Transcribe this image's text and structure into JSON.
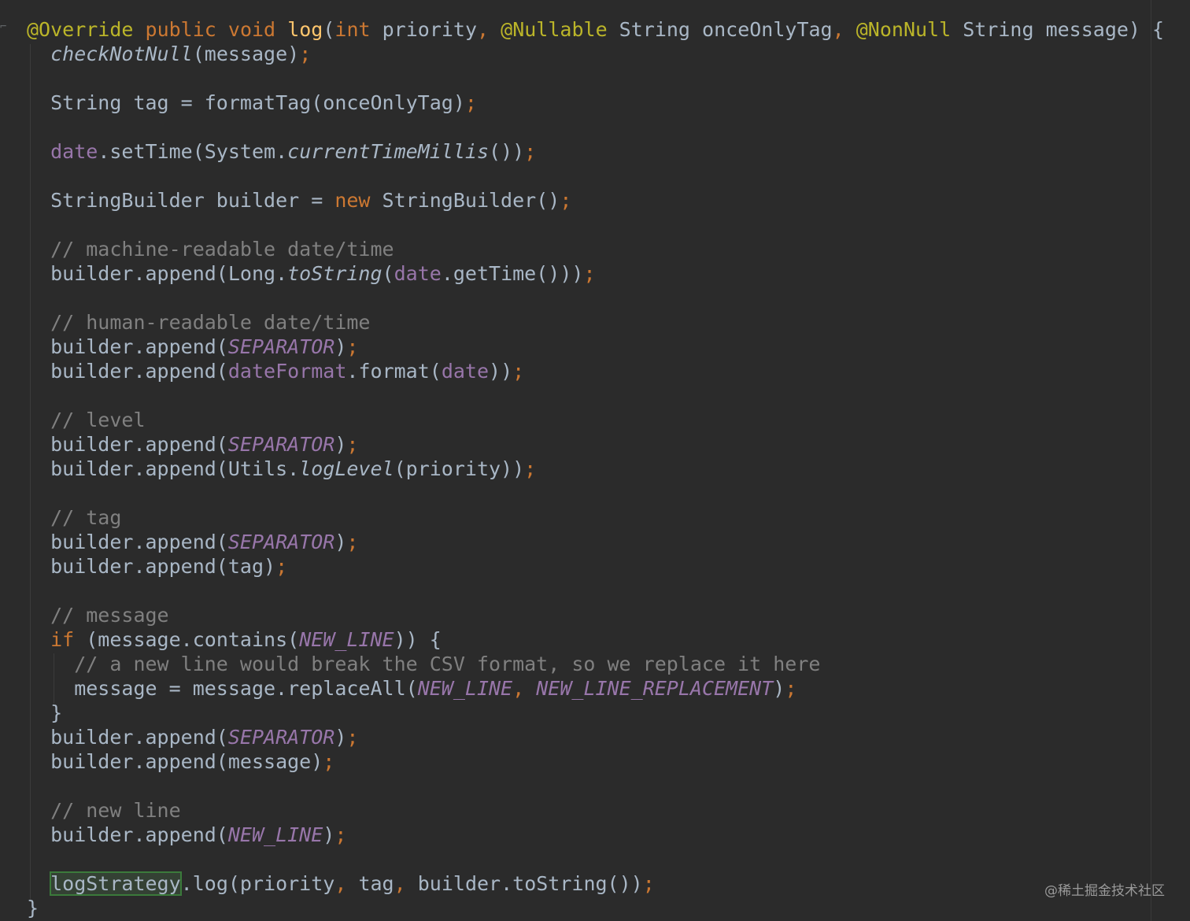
{
  "editor": {
    "language": "Java",
    "theme": "dark",
    "colors": {
      "background": "#2b2b2b",
      "text": "#a9b7c6",
      "keyword": "#cc7832",
      "annotation": "#bbb529",
      "field": "#9876aa",
      "method_decl": "#ffc66d",
      "comment": "#808080",
      "highlight_border": "#3b7a3b"
    },
    "highlighted_identifier": "logStrategy",
    "lines": [
      "@Override public void log(int priority, @Nullable String onceOnlyTag, @NonNull String message) {",
      "  checkNotNull(message);",
      "",
      "  String tag = formatTag(onceOnlyTag);",
      "",
      "  date.setTime(System.currentTimeMillis());",
      "",
      "  StringBuilder builder = new StringBuilder();",
      "",
      "  // machine-readable date/time",
      "  builder.append(Long.toString(date.getTime()));",
      "",
      "  // human-readable date/time",
      "  builder.append(SEPARATOR);",
      "  builder.append(dateFormat.format(date));",
      "",
      "  // level",
      "  builder.append(SEPARATOR);",
      "  builder.append(Utils.logLevel(priority));",
      "",
      "  // tag",
      "  builder.append(SEPARATOR);",
      "  builder.append(tag);",
      "",
      "  // message",
      "  if (message.contains(NEW_LINE)) {",
      "    // a new line would break the CSV format, so we replace it here",
      "    message = message.replaceAll(NEW_LINE, NEW_LINE_REPLACEMENT);",
      "  }",
      "  builder.append(SEPARATOR);",
      "  builder.append(message);",
      "",
      "  // new line",
      "  builder.append(NEW_LINE);",
      "",
      "  logStrategy.log(priority, tag, builder.toString());",
      "}"
    ]
  },
  "watermark": "@稀土掘金技术社区"
}
